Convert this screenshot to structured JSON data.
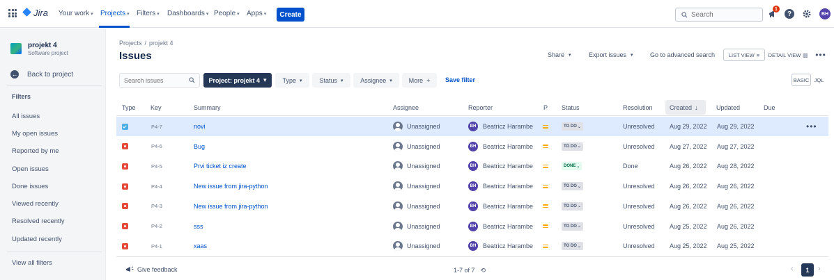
{
  "topnav": {
    "logo_text": "Jira",
    "items": [
      {
        "label": "Your work"
      },
      {
        "label": "Projects"
      },
      {
        "label": "Filters"
      },
      {
        "label": "Dashboards"
      },
      {
        "label": "People"
      },
      {
        "label": "Apps"
      }
    ],
    "create_label": "Create",
    "search_placeholder": "Search",
    "notification_count": "1",
    "help_glyph": "?",
    "user_initials": "BH",
    "accent_color": "#0052cc"
  },
  "sidebar": {
    "project_name": "projekt 4",
    "project_type": "Software project",
    "back_label": "Back to project",
    "filters_heading": "Filters",
    "items": [
      {
        "label": "All issues"
      },
      {
        "label": "My open issues"
      },
      {
        "label": "Reported by me"
      },
      {
        "label": "Open issues"
      },
      {
        "label": "Done issues"
      },
      {
        "label": "Viewed recently"
      },
      {
        "label": "Resolved recently"
      },
      {
        "label": "Updated recently"
      }
    ],
    "view_all_label": "View all filters"
  },
  "page": {
    "breadcrumb": [
      "Projects",
      "projekt 4"
    ],
    "breadcrumb_sep": "/",
    "title": "Issues",
    "share_label": "Share",
    "export_label": "Export issues",
    "advanced_label": "Go to advanced search",
    "list_view_label": "LIST VIEW",
    "detail_view_label": "DETAIL VIEW"
  },
  "filters": {
    "search_placeholder": "Search issues",
    "project_label": "Project: projekt 4",
    "type_label": "Type",
    "status_label": "Status",
    "assignee_label": "Assignee",
    "more_label": "More",
    "save_filter_label": "Save filter",
    "basic_label": "BASIC",
    "jql_label": "JQL"
  },
  "table": {
    "headers": {
      "type": "Type",
      "key": "Key",
      "summary": "Summary",
      "assignee": "Assignee",
      "reporter": "Reporter",
      "priority": "P",
      "status": "Status",
      "resolution": "Resolution",
      "created": "Created",
      "updated": "Updated",
      "due": "Due"
    },
    "rows": [
      {
        "type": "story",
        "key": "P4-7",
        "summary": "novi",
        "assignee": "Unassigned",
        "reporter": "Beatricz Harambe",
        "reporter_initials": "BH",
        "status": "TO DO",
        "resolution": "Unresolved",
        "created": "Aug 29, 2022",
        "updated": "Aug 29, 2022",
        "selected": true
      },
      {
        "type": "bug",
        "key": "P4-6",
        "summary": "Bug",
        "assignee": "Unassigned",
        "reporter": "Beatricz Harambe",
        "reporter_initials": "BH",
        "status": "TO DO",
        "resolution": "Unresolved",
        "created": "Aug 27, 2022",
        "updated": "Aug 27, 2022"
      },
      {
        "type": "bug",
        "key": "P4-5",
        "summary": "Prvi ticket iz create",
        "assignee": "Unassigned",
        "reporter": "Beatricz Harambe",
        "reporter_initials": "BH",
        "status": "DONE",
        "resolution": "Done",
        "created": "Aug 26, 2022",
        "updated": "Aug 28, 2022"
      },
      {
        "type": "bug",
        "key": "P4-4",
        "summary": "New issue from jira-python",
        "assignee": "Unassigned",
        "reporter": "Beatricz Harambe",
        "reporter_initials": "BH",
        "status": "TO DO",
        "resolution": "Unresolved",
        "created": "Aug 26, 2022",
        "updated": "Aug 26, 2022"
      },
      {
        "type": "bug",
        "key": "P4-3",
        "summary": "New issue from jira-python",
        "assignee": "Unassigned",
        "reporter": "Beatricz Harambe",
        "reporter_initials": "BH",
        "status": "TO DO",
        "resolution": "Unresolved",
        "created": "Aug 26, 2022",
        "updated": "Aug 26, 2022"
      },
      {
        "type": "bug",
        "key": "P4-2",
        "summary": "sss",
        "assignee": "Unassigned",
        "reporter": "Beatricz Harambe",
        "reporter_initials": "BH",
        "status": "TO DO",
        "resolution": "Unresolved",
        "created": "Aug 25, 2022",
        "updated": "Aug 26, 2022"
      },
      {
        "type": "bug",
        "key": "P4-1",
        "summary": "xaas",
        "assignee": "Unassigned",
        "reporter": "Beatricz Harambe",
        "reporter_initials": "BH",
        "status": "TO DO",
        "resolution": "Unresolved",
        "created": "Aug 25, 2022",
        "updated": "Aug 25, 2022"
      }
    ]
  },
  "footer": {
    "feedback_label": "Give feedback",
    "count_label": "1-7 of 7",
    "current_page": "1"
  }
}
